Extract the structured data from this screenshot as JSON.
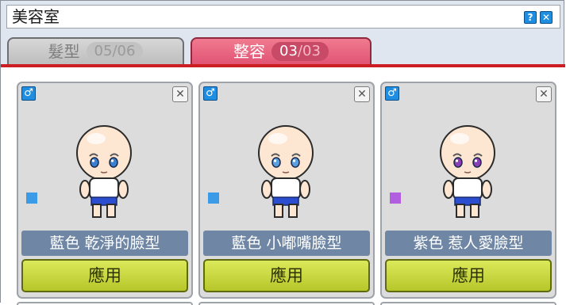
{
  "window": {
    "title": "美容室"
  },
  "tabs": [
    {
      "label": "髮型",
      "current": "05",
      "separator": "/",
      "total": "06",
      "active": false
    },
    {
      "label": "整容",
      "current": "03",
      "separator": "/",
      "total": "03",
      "active": true
    }
  ],
  "cards": [
    {
      "gender_icon": "male-icon",
      "label": "藍色 乾淨的臉型",
      "color": "#3b9be6",
      "eye_color": "#3a7fd0",
      "apply_label": "應用"
    },
    {
      "gender_icon": "male-icon",
      "label": "藍色 小嘟嘴臉型",
      "color": "#3b9be6",
      "eye_color": "#5aa0e0",
      "apply_label": "應用"
    },
    {
      "gender_icon": "male-icon",
      "label": "紫色 惹人愛臉型",
      "color": "#b15fe0",
      "eye_color": "#8a3fb8",
      "apply_label": "應用"
    }
  ],
  "colors": {
    "active_tab": "#e05272",
    "accent_line": "#cc1d23",
    "apply_button": "#c7d63a",
    "label_bg": "#6f87a4"
  }
}
